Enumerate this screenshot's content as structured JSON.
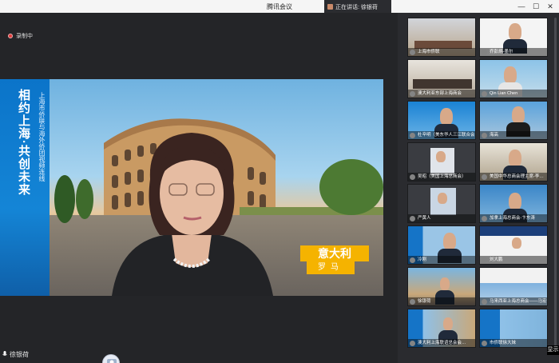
{
  "window": {
    "title": "腾讯会议",
    "speaking_label": "正在讲话: 徐银荷",
    "minimize": "—",
    "maximize": "☐",
    "close": "✕"
  },
  "recording": {
    "label": "录制中"
  },
  "main": {
    "banner_title": "相约上海·共创未来",
    "banner_subtitle": "上海市侨联与海外侨团视频连线",
    "place_country": "意大利",
    "place_city": "罗马",
    "speaker_name": "徐银荷",
    "show_button": "显示"
  },
  "gallery": {
    "tiles": [
      {
        "label": "上海市侨联"
      },
      {
        "label": "乔彭炳-墨尔"
      },
      {
        "label": "澳大利亚东部上海商会"
      },
      {
        "label": "Qin Lian Chen"
      },
      {
        "label": "杜辛明（美东华人三江联合会…"
      },
      {
        "label": "海高"
      },
      {
        "label": "吴昭（美国上海总商会）"
      },
      {
        "label": "美国中华总商会理主席-李…"
      },
      {
        "label": "严黄人"
      },
      {
        "label": "加拿上海总商会-卞东涛"
      },
      {
        "label": "冷刚"
      },
      {
        "label": "刘大鹏"
      },
      {
        "label": "徐银荷"
      },
      {
        "label": "马来西亚上海总商会——马宏信"
      },
      {
        "label": "澳大利上海联谊总会会…"
      },
      {
        "label": "市侨联徐大妹"
      }
    ]
  }
}
